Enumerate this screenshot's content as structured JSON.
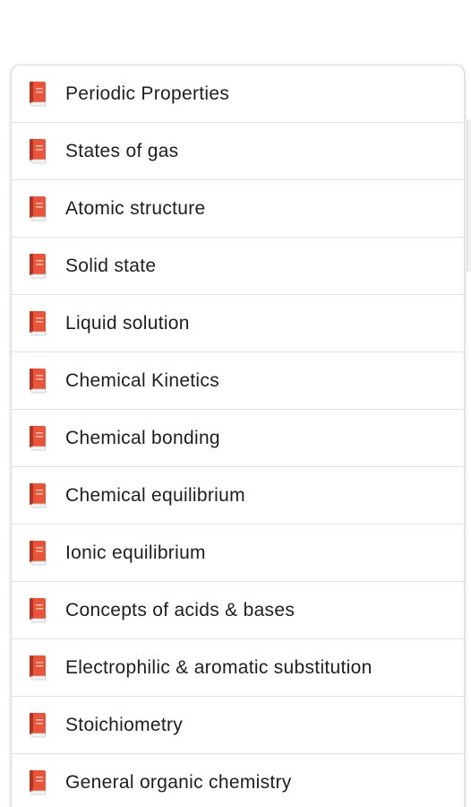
{
  "list": {
    "items": [
      {
        "label": "Periodic Properties",
        "icon": "book-icon"
      },
      {
        "label": "States of gas",
        "icon": "book-icon"
      },
      {
        "label": "Atomic structure",
        "icon": "book-icon"
      },
      {
        "label": "Solid state",
        "icon": "book-icon"
      },
      {
        "label": "Liquid solution",
        "icon": "book-icon"
      },
      {
        "label": "Chemical Kinetics",
        "icon": "book-icon"
      },
      {
        "label": "Chemical bonding",
        "icon": "book-icon"
      },
      {
        "label": "Chemical equilibrium",
        "icon": "book-icon"
      },
      {
        "label": "Ionic equilibrium",
        "icon": "book-icon"
      },
      {
        "label": "Concepts of acids & bases",
        "icon": "book-icon"
      },
      {
        "label": "Electrophilic & aromatic substitution",
        "icon": "book-icon"
      },
      {
        "label": "Stoichiometry",
        "icon": "book-icon"
      },
      {
        "label": "General organic chemistry",
        "icon": "book-icon"
      }
    ]
  },
  "colors": {
    "icon_primary": "#e8553a",
    "icon_dark": "#b8321f",
    "icon_pages": "#f4f4f4",
    "text": "#1e1e1e",
    "divider": "#e2e2e2"
  }
}
